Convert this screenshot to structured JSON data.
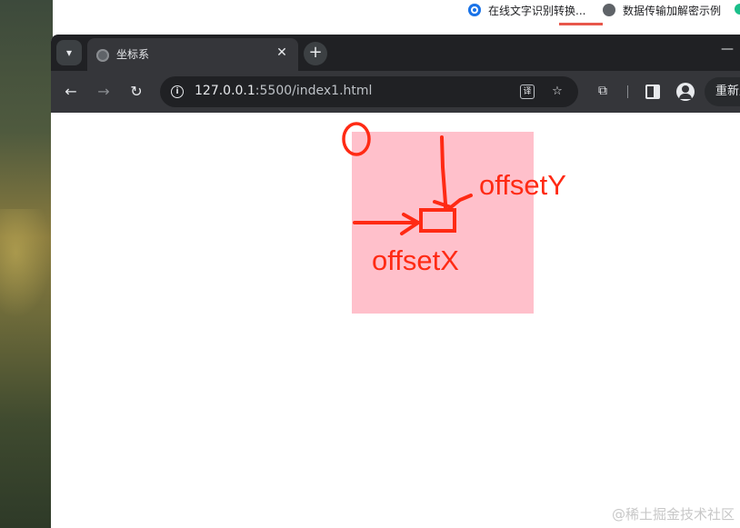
{
  "top_strip": {
    "items": [
      {
        "label": "在线文字识别转换...",
        "icon": "gear-icon"
      },
      {
        "label": "数据传输加解密示例",
        "icon": "globe-icon"
      }
    ],
    "colors": {
      "gear": "#1a73e8",
      "accent_underline": "#e8574b",
      "dot": "#1bbf8a"
    }
  },
  "browser": {
    "tab": {
      "title": "坐标系",
      "favicon": "globe-icon"
    },
    "new_tab_symbol": "+",
    "tab_close_symbol": "✕",
    "minimize_symbol": "—",
    "url_host": "127.0.0.1",
    "url_rest": ":5500/index1.html",
    "relaunch_label": "重新启动",
    "icons": [
      "back-arrow-icon",
      "forward-arrow-icon",
      "reload-icon",
      "info-icon",
      "translate-icon",
      "star-icon",
      "extensions-icon",
      "side-panel-icon",
      "profile-icon"
    ]
  },
  "page": {
    "box_color": "#ffc0cb",
    "annotation_color": "#ff2a14",
    "labels": {
      "offset_y": "offsetY",
      "offset_x": "offsetX"
    }
  },
  "watermark": "@稀土掘金技术社区"
}
